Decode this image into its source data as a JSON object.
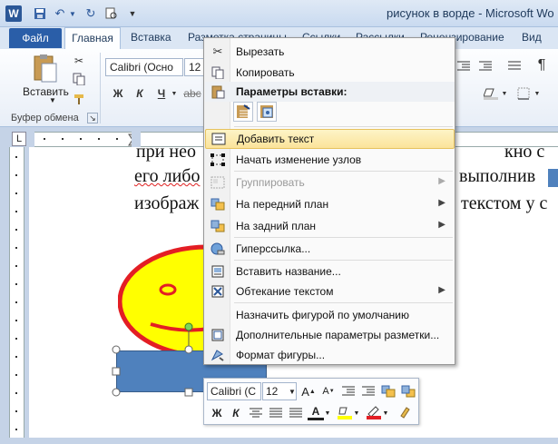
{
  "titlebar": {
    "title": "рисунок в ворде - Microsoft Wo",
    "app_icon": "W",
    "quick_access": [
      "save-icon",
      "undo-icon",
      "redo-icon",
      "print-preview-icon",
      "customize-icon"
    ]
  },
  "tabs": {
    "file": "Файл",
    "items": [
      "Главная",
      "Вставка",
      "Разметка страницы",
      "Ссылки",
      "Рассылки",
      "Рецензирование",
      "Вид"
    ]
  },
  "ribbon": {
    "paste_label": "Вставить",
    "clipboard_label": "Буфер обмена",
    "font_name": "Calibri (Осно",
    "font_size": "12",
    "format_buttons": [
      "Ж",
      "К",
      "Ч",
      "abc"
    ]
  },
  "document": {
    "line1_left": "при нео",
    "line1_right": "кно с",
    "line2_left": "его либо",
    "line2_right": "выполнив",
    "line3_left": "изображ",
    "line3_right": "текстом у с"
  },
  "context_menu": {
    "items": [
      {
        "label": "Вырезать",
        "icon": "scissors-icon"
      },
      {
        "label": "Копировать",
        "icon": "copy-icon"
      },
      {
        "label": "Параметры вставки:",
        "icon": "paste-options-icon"
      },
      {
        "label": "Добавить текст",
        "icon": "text-box-icon",
        "highlighted": true
      },
      {
        "label": "Начать изменение узлов",
        "icon": "edit-points-icon"
      },
      {
        "label": "Группировать",
        "icon": "group-icon",
        "disabled": true
      },
      {
        "label": "На передний план",
        "icon": "bring-front-icon"
      },
      {
        "label": "На задний план",
        "icon": "send-back-icon"
      },
      {
        "label": "Гиперссылка...",
        "icon": "hyperlink-icon"
      },
      {
        "label": "Вставить название...",
        "icon": "caption-icon"
      },
      {
        "label": "Обтекание текстом",
        "icon": "text-wrap-icon"
      },
      {
        "label": "Назначить фигурой по умолчанию",
        "icon": ""
      },
      {
        "label": "Дополнительные параметры разметки...",
        "icon": "layout-icon"
      },
      {
        "label": "Формат фигуры...",
        "icon": "format-shape-icon"
      }
    ]
  },
  "mini_toolbar": {
    "font_name": "Calibri (С",
    "font_size": "12",
    "row2": [
      "Ж",
      "К"
    ]
  },
  "colors": {
    "shape_fill": "#4f81bd",
    "smiley_fill": "#ffff00",
    "smiley_stroke": "#e31e24",
    "highlight": "#fbe39a",
    "file_tab": "#2a5ea8"
  }
}
